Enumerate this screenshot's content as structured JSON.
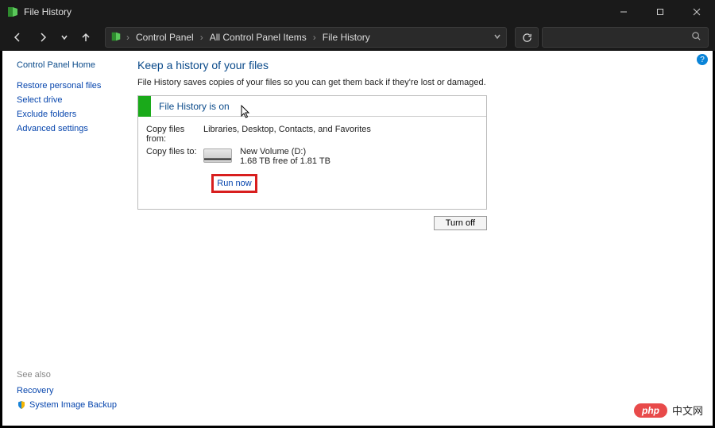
{
  "window": {
    "title": "File History"
  },
  "breadcrumbs": {
    "item1": "Control Panel",
    "item2": "All Control Panel Items",
    "item3": "File History"
  },
  "sidebar": {
    "home": "Control Panel Home",
    "links": {
      "restore": "Restore personal files",
      "select_drive": "Select drive",
      "exclude": "Exclude folders",
      "advanced": "Advanced settings"
    }
  },
  "seealso": {
    "header": "See also",
    "recovery": "Recovery",
    "sysimage": "System Image Backup"
  },
  "main": {
    "heading": "Keep a history of your files",
    "description": "File History saves copies of your files so you can get them back if they're lost or damaged.",
    "panel_title": "File History is on",
    "copy_from_label": "Copy files from:",
    "copy_from_value": "Libraries, Desktop, Contacts, and Favorites",
    "copy_to_label": "Copy files to:",
    "drive_name": "New Volume (D:)",
    "drive_space": "1.68 TB free of 1.81 TB",
    "run_now": "Run now",
    "turn_off": "Turn off"
  },
  "help_badge": "?",
  "watermark": {
    "pill": "php",
    "text": "中文网"
  }
}
